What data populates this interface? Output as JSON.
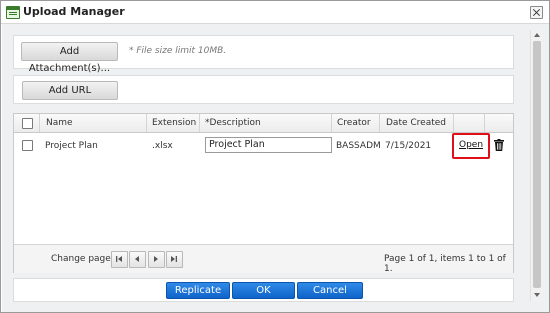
{
  "window": {
    "title": "Upload Manager"
  },
  "attachments": {
    "add_attachment_label": "Add Attachment(s)...",
    "hint": "* File size limit 10MB."
  },
  "url": {
    "add_url_label": "Add URL"
  },
  "grid": {
    "columns": [
      "Name",
      "Extension",
      "*Description",
      "Creator",
      "Date Created"
    ],
    "rows": [
      {
        "name": "Project Plan",
        "extension": ".xlsx",
        "description": "Project Plan",
        "creator": "BASSADM",
        "date_created": "7/15/2021",
        "open_label": "Open"
      }
    ]
  },
  "pager": {
    "label": "Change page:",
    "info": "Page 1 of 1, items 1 to 1 of 1."
  },
  "footer": {
    "replicate_label": "Replicate",
    "ok_label": "OK",
    "cancel_label": "Cancel"
  },
  "icons": [
    "window-icon",
    "close-icon",
    "trash-icon",
    "first-page-icon",
    "prev-page-icon",
    "next-page-icon",
    "last-page-icon"
  ],
  "colors": {
    "primary_button": "#1873d3",
    "highlight": "#e0101a"
  }
}
